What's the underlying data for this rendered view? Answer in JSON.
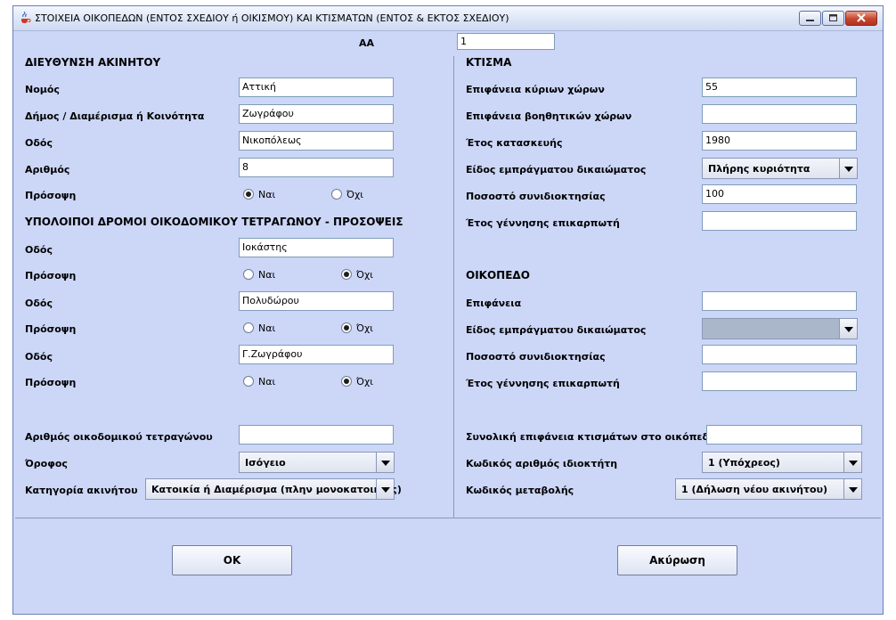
{
  "title": "ΣΤΟΙΧΕΙΑ ΟΙΚΟΠΕΔΩΝ (ΕΝΤΟΣ ΣΧΕΔΙΟΥ ή ΟΙΚΙΣΜΟΥ) ΚΑΙ ΚΤΙΣΜΑΤΩΝ (ΕΝΤΟΣ & ΕΚΤΟΣ ΣΧΕΔΙΟΥ)",
  "aa": {
    "label": "ΑΑ",
    "value": "1"
  },
  "address": {
    "header": "ΔΙΕΥΘΥΝΣΗ ΑΚΙΝΗΤΟΥ",
    "nomos": {
      "label": "Νομός",
      "value": "Αττική"
    },
    "dimos": {
      "label": "Δήμος / Διαμέρισμα ή Κοινότητα",
      "value": "Ζωγράφου"
    },
    "odos": {
      "label": "Οδός",
      "value": "Νικοπόλεως"
    },
    "arithmos": {
      "label": "Αριθμός",
      "value": "8"
    },
    "prosopsi": {
      "label": "Πρόσοψη",
      "yes": "Ναι",
      "no": "Όχι",
      "selected": "yes"
    }
  },
  "other_streets": {
    "header": "ΥΠΟΛΟΙΠΟΙ ΔΡΟΜΟΙ ΟΙΚΟΔΟΜΙΚΟΥ ΤΕΤΡΑΓΩΝΟΥ - ΠΡΟΣΟΨΕΙΣ",
    "streets": [
      {
        "odos_label": "Οδός",
        "odos_value": "Ιοκάστης",
        "prosopsi_label": "Πρόσοψη",
        "yes": "Ναι",
        "no": "Όχι",
        "selected": "no"
      },
      {
        "odos_label": "Οδός",
        "odos_value": "Πολυδώρου",
        "prosopsi_label": "Πρόσοψη",
        "yes": "Ναι",
        "no": "Όχι",
        "selected": "no"
      },
      {
        "odos_label": "Οδός",
        "odos_value": "Γ.Ζωγράφου",
        "prosopsi_label": "Πρόσοψη",
        "yes": "Ναι",
        "no": "Όχι",
        "selected": "no"
      }
    ]
  },
  "block": {
    "arithmos_label": "Αριθμός οικοδομικού τετραγώνου",
    "arithmos_value": "",
    "orofos_label": "Όροφος",
    "orofos_value": "Ισόγειο",
    "katigoria_label": "Κατηγορία ακινήτου",
    "katigoria_value": "Κατοικία ή Διαμέρισμα (πλην μονοκατοικίας)"
  },
  "ktisma": {
    "header": "ΚΤΙΣΜΑ",
    "kyrioi": {
      "label": "Επιφάνεια κύριων χώρων",
      "value": "55"
    },
    "voithitikoi": {
      "label": "Επιφάνεια βοηθητικών χώρων",
      "value": ""
    },
    "etos": {
      "label": "Έτος κατασκευής",
      "value": "1980"
    },
    "eidos": {
      "label": "Είδος εμπράγματου δικαιώματος",
      "value": "Πλήρης κυριότητα"
    },
    "pososto": {
      "label": "Ποσοστό συνιδιοκτησίας",
      "value": "100"
    },
    "gennisi": {
      "label": "Έτος γέννησης επικαρπωτή",
      "value": ""
    }
  },
  "oikopedo": {
    "header": "ΟΙΚΟΠΕΔΟ",
    "epifaneia": {
      "label": "Επιφάνεια",
      "value": ""
    },
    "eidos": {
      "label": "Είδος εμπράγματου δικαιώματος",
      "value": ""
    },
    "pososto": {
      "label": "Ποσοστό συνιδιοκτησίας",
      "value": ""
    },
    "gennisi": {
      "label": "Έτος γέννησης επικαρπωτή",
      "value": ""
    }
  },
  "totals": {
    "synoliki_label": "Συνολική επιφάνεια κτισμάτων στο οικόπεδο",
    "synoliki_value": "",
    "kodikos_idiokti_label": "Κωδικός αριθμός ιδιοκτήτη",
    "kodikos_idiokti_value": "1 (Υπόχρεος)",
    "kodikos_metavolis_label": "Κωδικός μεταβολής",
    "kodikos_metavolis_value": "1 (Δήλωση νέου ακινήτου)"
  },
  "buttons": {
    "ok": "OK",
    "cancel": "Ακύρωση"
  },
  "colors": {
    "background": "#ccd6f7",
    "border": "#7f9db9",
    "disabled_combo": "#aab7cb"
  }
}
